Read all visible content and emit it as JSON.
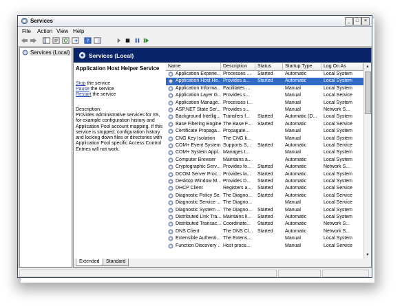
{
  "window": {
    "title": "Services"
  },
  "window_controls": {
    "minimize": "_",
    "maximize": "□",
    "close": "×"
  },
  "menu": [
    {
      "label": "File"
    },
    {
      "label": "Action"
    },
    {
      "label": "View"
    },
    {
      "label": "Help"
    }
  ],
  "tree": {
    "root_label": "Services (Local)"
  },
  "panel": {
    "title": "Services (Local)"
  },
  "details": {
    "service_name": "Application Host Helper Service",
    "actions": [
      {
        "link": "Stop",
        "rest": " the service"
      },
      {
        "link": "Pause",
        "rest": " the service"
      },
      {
        "link": "Restart",
        "rest": " the service"
      }
    ],
    "description_label": "Description:",
    "description_text": "Provides administrative services for IIS, for example configuration history and Application Pool account mapping. If this service is stopped, configuration history and locking down files or directories with Application Pool specific Access Control Entries will not work."
  },
  "table": {
    "columns": [
      "Name",
      "Description",
      "Status",
      "Startup Type",
      "Log On As"
    ],
    "selected_index": 1,
    "rows": [
      [
        "Application Experie...",
        "Processes ...",
        "Started",
        "Automatic",
        "Local System"
      ],
      [
        "Application Host He...",
        "Provides a...",
        "Started",
        "Automatic",
        "Local System"
      ],
      [
        "Application Informa...",
        "Facilitates ...",
        "",
        "Manual",
        "Local System"
      ],
      [
        "Application Layer G...",
        "Provides s...",
        "",
        "Manual",
        "Local Service"
      ],
      [
        "Application Manage...",
        "Processes i...",
        "",
        "Manual",
        "Local System"
      ],
      [
        "ASP.NET State Ser...",
        "Provides s...",
        "",
        "Manual",
        "Network S..."
      ],
      [
        "Background Intellig...",
        "Transfers f...",
        "Started",
        "Automatic (D...",
        "Local System"
      ],
      [
        "Base Filtering Engine",
        "The Base F...",
        "Started",
        "Automatic",
        "Local Service"
      ],
      [
        "Certificate Propaga...",
        "Propagate...",
        "",
        "Manual",
        "Local System"
      ],
      [
        "CNG Key Isolation",
        "The CNG k...",
        "",
        "Manual",
        "Local System"
      ],
      [
        "COM+ Event System",
        "Supports S...",
        "Started",
        "Automatic",
        "Local Service"
      ],
      [
        "COM+ System Appl...",
        "Manages t...",
        "",
        "Manual",
        "Local System"
      ],
      [
        "Computer Browser",
        "Maintains a...",
        "",
        "Automatic",
        "Local System"
      ],
      [
        "Cryptographic Serv...",
        "Provides fo...",
        "Started",
        "Automatic",
        "Network S..."
      ],
      [
        "DCOM Server Proc...",
        "Provides la...",
        "Started",
        "Automatic",
        "Local System"
      ],
      [
        "Desktop Window M...",
        "Provides D...",
        "Started",
        "Automatic",
        "Local System"
      ],
      [
        "DHCP Client",
        "Registers a...",
        "Started",
        "Automatic",
        "Local Service"
      ],
      [
        "Diagnostic Policy Se...",
        "The Diagno...",
        "Started",
        "Automatic",
        "Local Service"
      ],
      [
        "Diagnostic Service ...",
        "The Diagno...",
        "",
        "Manual",
        "Local Service"
      ],
      [
        "Diagnostic System ...",
        "The Diagno...",
        "Started",
        "Manual",
        "Local System"
      ],
      [
        "Distributed Link Tra...",
        "Maintains li...",
        "Started",
        "Automatic",
        "Local System"
      ],
      [
        "Distributed Transac...",
        "Coordinate...",
        "Started",
        "Automatic",
        "Network S..."
      ],
      [
        "DNS Client",
        "The DNS Cl...",
        "Started",
        "Automatic",
        "Network S..."
      ],
      [
        "Extensible Authenti...",
        "The Extens...",
        "",
        "Manual",
        "Local System"
      ],
      [
        "Function Discovery ...",
        "Host proce...",
        "",
        "Manual",
        "Local Service"
      ]
    ]
  },
  "tabs": [
    {
      "label": "Extended"
    },
    {
      "label": "Standard"
    }
  ],
  "icons": {
    "app": "services-gear-icon",
    "toolbar": [
      "back-icon",
      "forward-icon",
      "console-tree-icon",
      "properties-icon",
      "refresh-icon",
      "export-icon",
      "help-icon",
      "show-hide-icon",
      "start-icon",
      "stop-icon",
      "pause-icon",
      "restart-icon"
    ]
  },
  "colors": {
    "title_bar": "#0a246a",
    "selection": "#316ac5",
    "link": "#1c3fb4"
  }
}
